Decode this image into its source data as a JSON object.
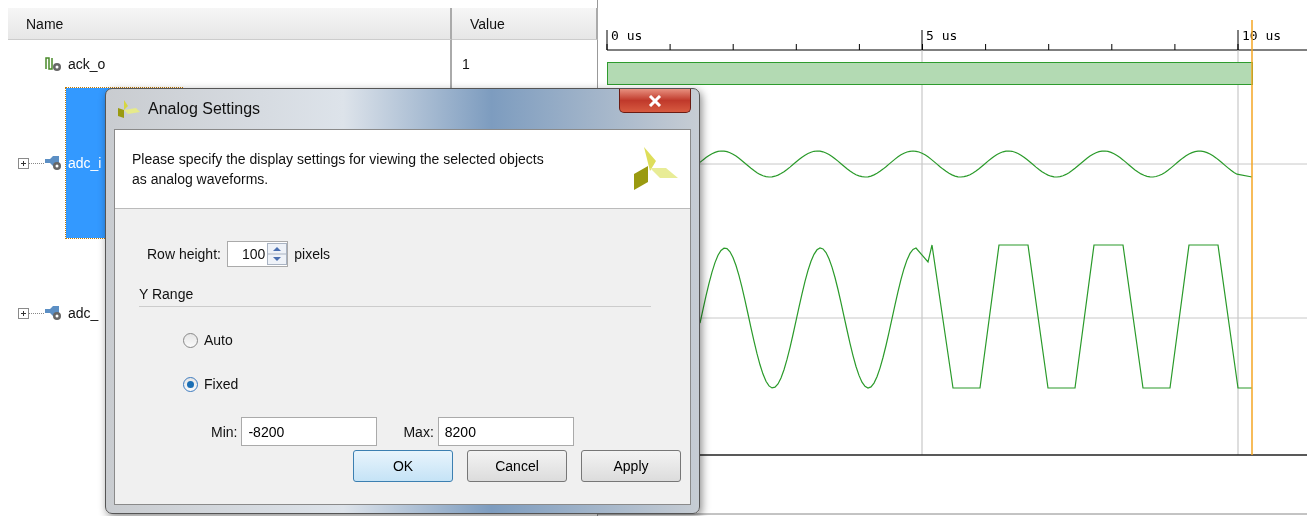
{
  "signals_panel": {
    "columns": [
      "Name",
      "Value"
    ],
    "signals": [
      {
        "name": "ack_o",
        "value": "1",
        "kind": "bit",
        "selected": false
      },
      {
        "name": "adc_i",
        "kind": "bus",
        "selected": true
      },
      {
        "name": "adc_",
        "kind": "bus",
        "selected": false
      }
    ]
  },
  "waveform_view": {
    "time_labels": [
      "0 us",
      "5 us",
      "10 us"
    ]
  },
  "dialog": {
    "title": "Analog Settings",
    "description": "Please specify the display settings for viewing the selected objects as analog waveforms.",
    "row_height": {
      "label": "Row height:",
      "value": "100",
      "unit": "pixels"
    },
    "y_range": {
      "title": "Y Range",
      "options": [
        {
          "label": "Auto",
          "selected": false
        },
        {
          "label": "Fixed",
          "selected": true
        }
      ],
      "min": {
        "label": "Min:",
        "value": "-8200"
      },
      "max": {
        "label": "Max:",
        "value": "8200"
      }
    },
    "buttons": [
      {
        "label": "OK",
        "default": true
      },
      {
        "label": "Cancel",
        "default": false
      },
      {
        "label": "Apply",
        "default": false
      }
    ]
  }
}
